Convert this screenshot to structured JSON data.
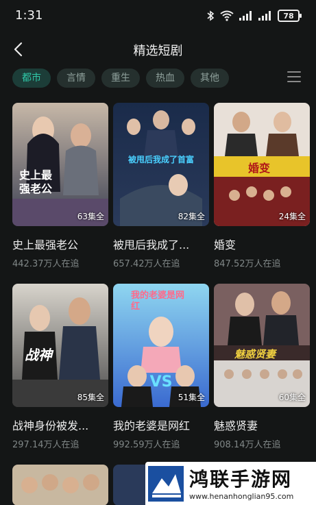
{
  "status": {
    "time": "1:31",
    "battery": "78"
  },
  "header": {
    "title": "精选短剧"
  },
  "tabs": [
    {
      "label": "都市",
      "active": true
    },
    {
      "label": "言情",
      "active": false
    },
    {
      "label": "重生",
      "active": false
    },
    {
      "label": "热血",
      "active": false
    },
    {
      "label": "其他",
      "active": false
    }
  ],
  "dramas": [
    {
      "title": "史上最强老公",
      "views": "442.37万人在追",
      "episodes": "63集全",
      "poster_text": "史上最强老公"
    },
    {
      "title": "被甩后我成了...",
      "views": "657.42万人在追",
      "episodes": "82集全",
      "poster_text": "被甩后我成了首富"
    },
    {
      "title": "婚变",
      "views": "847.52万人在追",
      "episodes": "24集全",
      "poster_text": "婚变"
    },
    {
      "title": "战神身份被发...",
      "views": "297.14万人在追",
      "episodes": "85集全",
      "poster_text": "战神"
    },
    {
      "title": "我的老婆是网红",
      "views": "992.59万人在追",
      "episodes": "51集全",
      "poster_text": "我的老婆是网红"
    },
    {
      "title": "魅惑贤妻",
      "views": "908.14万人在追",
      "episodes": "60集全",
      "poster_text": "魅惑贤妻"
    }
  ],
  "watermark": {
    "title": "鸿联手游网",
    "url": "www.henanhonglian95.com"
  },
  "colors": {
    "accent": "#2fc8a8",
    "background": "#141616"
  }
}
